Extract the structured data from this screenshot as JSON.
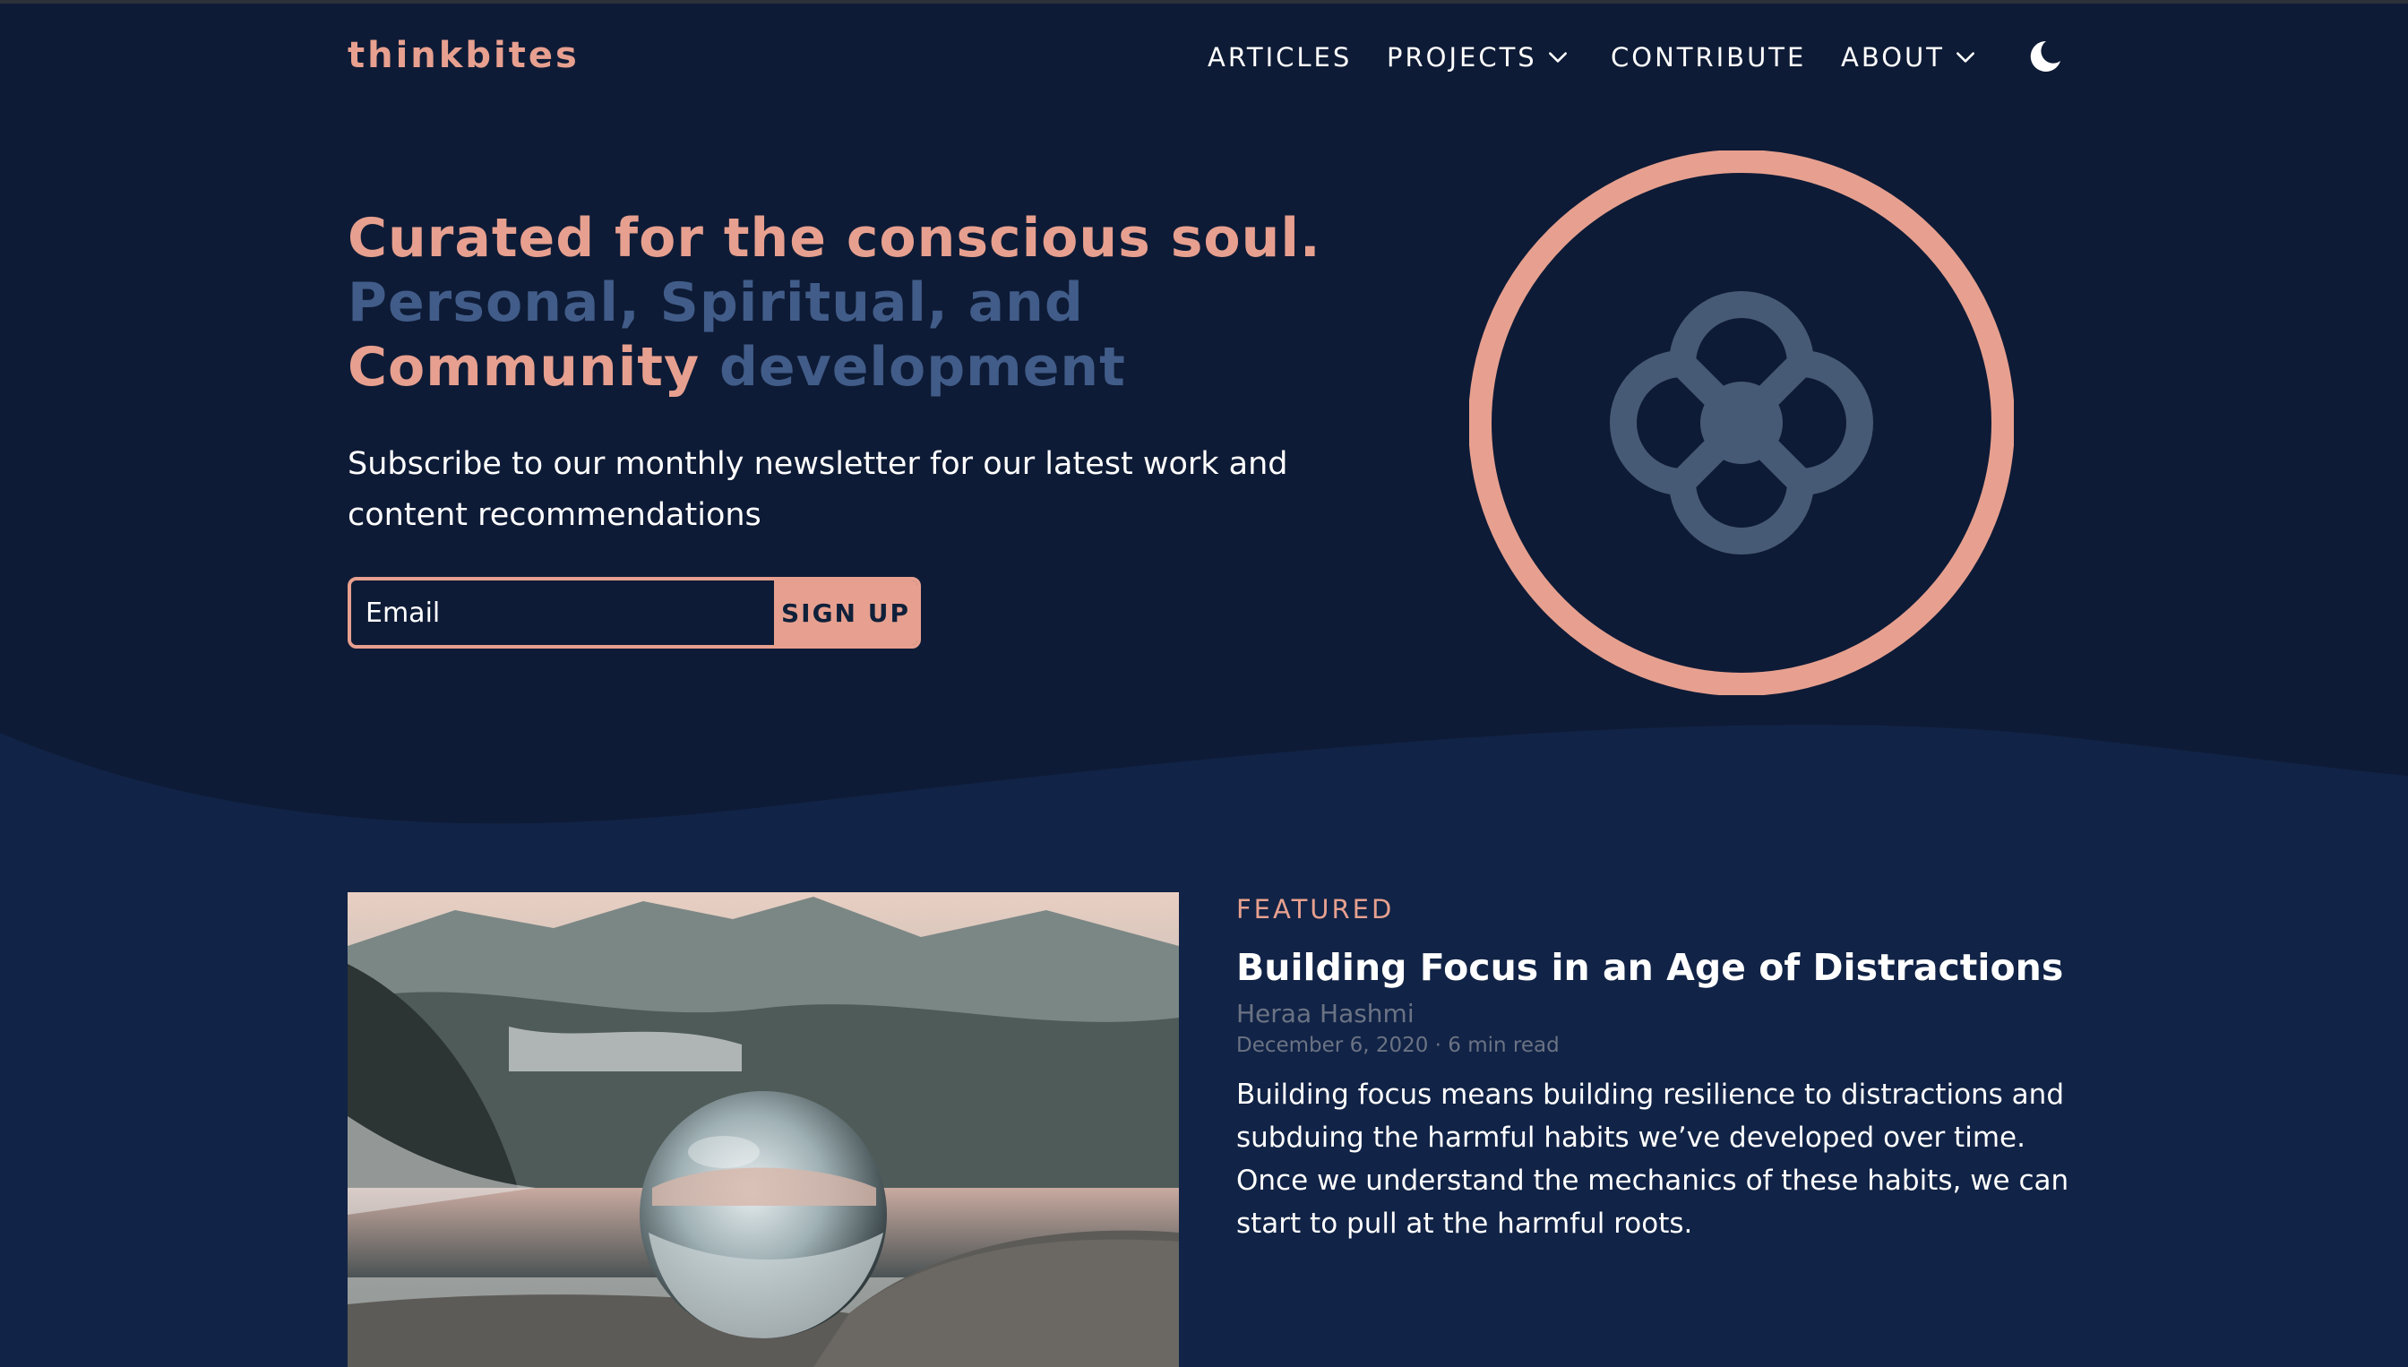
{
  "nav": {
    "logo": "thinkbites",
    "items": [
      {
        "label": "ARTICLES",
        "dropdown": false
      },
      {
        "label": "PROJECTS",
        "dropdown": true
      },
      {
        "label": "CONTRIBUTE",
        "dropdown": false
      },
      {
        "label": "ABOUT",
        "dropdown": true
      }
    ],
    "theme_toggle_icon": "moon-icon"
  },
  "hero": {
    "title_line1": "Curated for the conscious soul.",
    "title_line2": "Personal, Spiritual, and",
    "title_line3_a": "Community",
    "title_line3_b": "development",
    "subtitle": "Subscribe to our monthly newsletter for our latest work and content recommendations",
    "email_placeholder": "Email",
    "signup_label": "SIGN UP",
    "emblem_icon": "atom-flower-emblem"
  },
  "featured": {
    "label": "FEATURED",
    "title": "Building Focus in an Age of Distractions",
    "author": "Heraa Hashmi",
    "meta": "December 6, 2020 · 6 min read",
    "excerpt": "Building focus means building resilience to distractions and subduing the harmful habits we’ve developed over time. Once we understand the mechanics of these habits, we can start to pull at the harmful roots.",
    "image": "crystal-ball-on-rock-by-mountain-lake"
  },
  "colors": {
    "background": "#0e1b36",
    "section_background": "#112346",
    "accent_peach": "#e7a08f",
    "accent_blue": "#415c88",
    "emblem_gray": "#475a75",
    "muted_text": "#6b7384"
  }
}
